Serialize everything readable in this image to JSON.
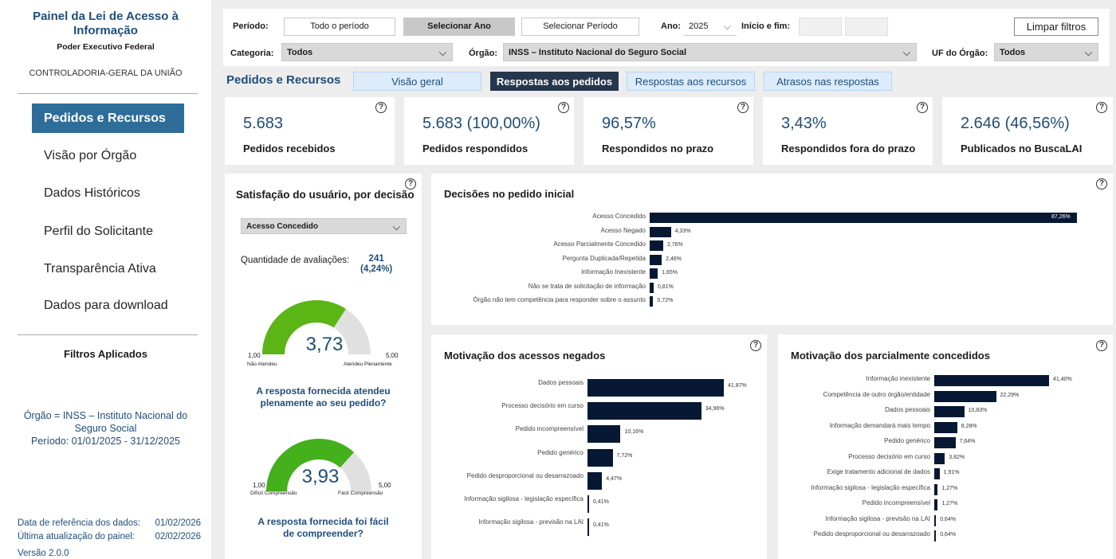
{
  "sidebar": {
    "title": "Painel da Lei de Acesso à Informação",
    "subtitle": "Poder Executivo Federal",
    "org": "CONTROLADORIA-GERAL DA UNIÃO",
    "nav": [
      {
        "label": "Pedidos e Recursos",
        "active": true
      },
      {
        "label": "Visão por Órgão",
        "active": false
      },
      {
        "label": "Dados Históricos",
        "active": false
      },
      {
        "label": "Perfil do Solicitante",
        "active": false
      },
      {
        "label": "Transparência Ativa",
        "active": false
      },
      {
        "label": "Dados para download",
        "active": false
      }
    ],
    "filters_title": "Filtros Aplicados",
    "filters_text_orgao": "Órgão = INSS – Instituto Nacional do Seguro Social",
    "filters_text_periodo": "Período: 01/01/2025 - 31/12/2025",
    "ref_label": "Data de referência dos dados:",
    "ref_value": "01/02/2026",
    "update_label": "Última atualização do painel:",
    "update_value": "02/02/2026",
    "version": "Versão 2.0.0"
  },
  "filters": {
    "periodo_label": "Período:",
    "periodo_options": [
      "Todo o período",
      "Selecionar Ano",
      "Selecionar Período"
    ],
    "periodo_selected": "Selecionar Ano",
    "ano_label": "Ano:",
    "ano_value": "2025",
    "inicio_fim_label": "Início e fim:",
    "clear_label": "Limpar filtros",
    "categoria_label": "Categoria:",
    "categoria_value": "Todos",
    "orgao_label": "Órgão:",
    "orgao_value": "INSS – Instituto Nacional do Seguro Social",
    "uf_label": "UF do Órgão:",
    "uf_value": "Todos"
  },
  "tabs": {
    "section_title": "Pedidos e Recursos",
    "items": [
      {
        "label": "Visão geral",
        "active": false
      },
      {
        "label": "Respostas aos pedidos",
        "active": true
      },
      {
        "label": "Respostas aos recursos",
        "active": false
      },
      {
        "label": "Atrasos nas respostas",
        "active": false
      }
    ]
  },
  "kpis": [
    {
      "value": "5.683",
      "label": "Pedidos recebidos"
    },
    {
      "value": "5.683 (100,00%)",
      "label": "Pedidos respondidos"
    },
    {
      "value": "96,57%",
      "label": "Respondidos no prazo"
    },
    {
      "value": "3,43%",
      "label": "Respondidos fora do prazo"
    },
    {
      "value": "2.646 (46,56%)",
      "label": "Publicados no BuscaLAI"
    }
  ],
  "satisfaction": {
    "title": "Satisfação do usuário, por decisão",
    "decision_select": "Acesso Concedido",
    "qtd_label": "Quantidade de avaliações:",
    "qtd_value": "241",
    "qtd_pct": "(4,24%)",
    "gauges": [
      {
        "value": 3.73,
        "value_label": "3,73",
        "min": "1,00",
        "max": "5,00",
        "min_caption": "Não Atendeu",
        "max_caption": "Atendeu Plenamente",
        "question": "A resposta fornecida atendeu plenamente ao seu pedido?",
        "color": "#5bb515"
      },
      {
        "value": 3.93,
        "value_label": "3,93",
        "min": "1,00",
        "max": "5,00",
        "min_caption": "Difícil Compreensão",
        "max_caption": "Fácil Compreensão",
        "question": "A resposta fornecida foi fácil de compreender?",
        "color": "#43b01c"
      }
    ]
  },
  "chart_data": [
    {
      "type": "bar",
      "title": "Decisões no pedido inicial",
      "categories": [
        "Acesso Concedido",
        "Acesso Negado",
        "Acesso Parcialmente Concedido",
        "Pergunta Duplicada/Repetida",
        "Informação Inexistente",
        "Não se trata de solicitação de informação",
        "Órgão não tem competência para responder sobre o assunto"
      ],
      "values": [
        87.26,
        4.33,
        2.76,
        2.46,
        1.65,
        0.81,
        0.72
      ],
      "labels": [
        "87,26%",
        "4,33%",
        "2,76%",
        "2,46%",
        "1,65%",
        "0,81%",
        "0,72%"
      ]
    },
    {
      "type": "bar",
      "title": "Motivação dos acessos negados",
      "categories": [
        "Dados pessoais",
        "Processo decisório em curso",
        "Pedido incompreensível",
        "Pedido genérico",
        "Pedido desproporcional ou desarrazoado",
        "Informação sigilosa - legislação específica",
        "Informação sigilosa - previsão na LAI"
      ],
      "values": [
        41.87,
        34.96,
        10.16,
        7.72,
        4.47,
        0.41,
        0.41
      ],
      "labels": [
        "41,87%",
        "34,96%",
        "10,16%",
        "7,72%",
        "4,47%",
        "0,41%",
        "0,41%"
      ]
    },
    {
      "type": "bar",
      "title": "Motivação dos parcialmente concedidos",
      "categories": [
        "Informação inexistente",
        "Competência de outro órgão/entidade",
        "Dados pessoais",
        "Informação demandará mais tempo",
        "Pedido genérico",
        "Processo decisório em curso",
        "Exige tratamento adicional de dados",
        "Informação sigilosa - legislação específica",
        "Pedido incompreensível",
        "Informação sigilosa - previsão na LAI",
        "Pedido desproporcional ou desarrazoado"
      ],
      "values": [
        41.4,
        22.29,
        10.83,
        8.28,
        7.64,
        3.82,
        1.91,
        1.27,
        1.27,
        0.64,
        0.64
      ],
      "labels": [
        "41,40%",
        "22,29%",
        "10,83%",
        "8,28%",
        "7,64%",
        "3,82%",
        "1,91%",
        "1,27%",
        "1,27%",
        "0,64%",
        "0,64%"
      ]
    }
  ],
  "colors": {
    "bar": "#061833",
    "accent": "#1f4e79",
    "nav_active": "#2e6d99",
    "tab_active": "#25364d",
    "gauge_track": "#e0e0e0"
  }
}
